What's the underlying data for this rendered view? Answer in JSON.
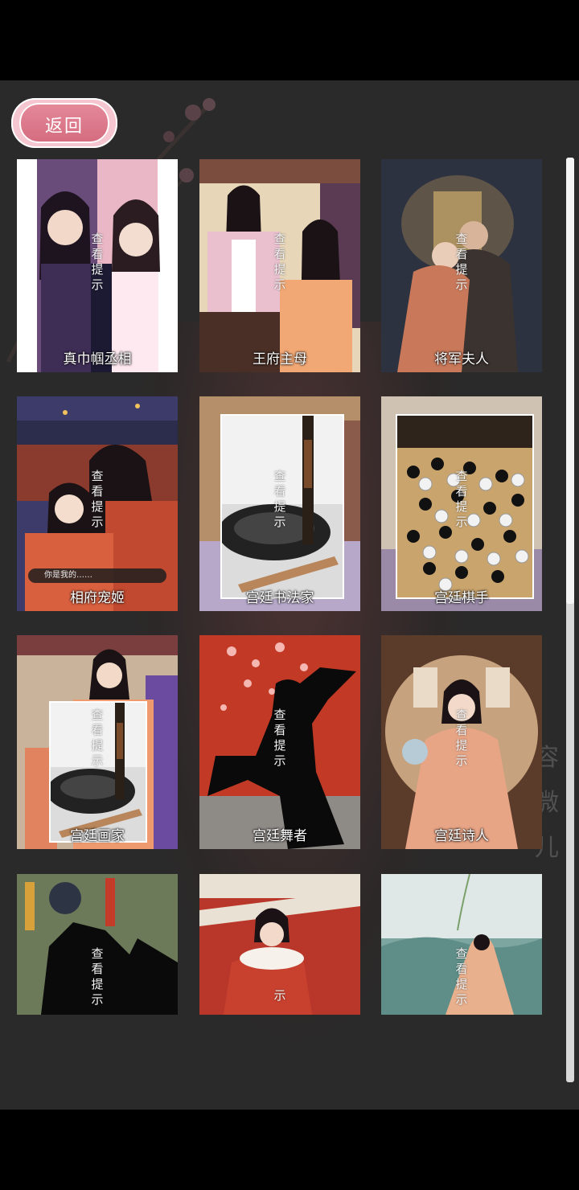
{
  "back_label": "返回",
  "hint_chars": [
    "查",
    "看",
    "提",
    "示"
  ],
  "watermark_chars": [
    "容",
    "微",
    "儿"
  ],
  "cards": [
    {
      "name": "真巾帼丞相",
      "theme": "#6a4c7a",
      "accent": "#e9b7c6",
      "vertical_title": "真·巾帼丞相"
    },
    {
      "name": "王府主母",
      "theme": "#c8a98a",
      "accent": "#7a4d3f"
    },
    {
      "name": "将军夫人",
      "theme": "#2d3240",
      "accent": "#7b5a3d"
    },
    {
      "name": "相府宠姬",
      "theme": "#3d3b6a",
      "accent": "#c0492f",
      "dialog": "你是我的……"
    },
    {
      "name": "宫廷书法家",
      "theme": "#b58e6a",
      "accent": "#26262a"
    },
    {
      "name": "宫廷棋手",
      "theme": "#cfc2b3",
      "accent": "#9a8aa8"
    },
    {
      "name": "宫廷画家",
      "theme": "#c9b39a",
      "accent": "#6b4ba0"
    },
    {
      "name": "宫廷舞者",
      "theme": "#c23a26",
      "accent": "#f4b7b2"
    },
    {
      "name": "宫廷诗人",
      "theme": "#8a5a3c",
      "accent": "#e8a586"
    },
    {
      "name": "",
      "theme": "#6c7a5a",
      "accent": "#c43b2a"
    },
    {
      "name": "",
      "theme": "#b9372a",
      "accent": "#e9e2d4"
    },
    {
      "name": "",
      "theme": "#7ea6a0",
      "accent": "#dfe8e6"
    }
  ]
}
